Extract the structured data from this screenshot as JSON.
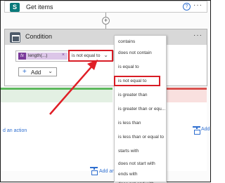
{
  "get_items": {
    "title": "Get items",
    "icon_letter": "S",
    "help": "?",
    "more": "···"
  },
  "insert": {
    "plus": "+"
  },
  "condition": {
    "title": "Condition",
    "more": "···",
    "token_label": "length(...)",
    "token_close": "×",
    "operator_value": "is not equal to",
    "operator_chevron": "⌄",
    "add_label": "Add",
    "add_plus": "+",
    "add_chevron": "⌄"
  },
  "branches": {
    "left_add_action": "d an action",
    "right_add_action": "Add",
    "bottom_add_action": "Add an a"
  },
  "dropdown": {
    "options": [
      "contains",
      "does not contain",
      "is equal to",
      "is not equal to",
      "is greater than",
      "is greater than or equ...",
      "is less than",
      "is less than or equal to",
      "starts with",
      "does not start with",
      "ends with",
      "does not end with"
    ],
    "selected_index": 3
  },
  "colors": {
    "highlight": "#d81c25",
    "accent": "#2f6fd0",
    "yes_branch": "#5db85d",
    "no_branch": "#d9534f",
    "sharepoint": "#0a7a7b",
    "token": "#dcc6e8"
  },
  "icons": [
    "sharepoint-icon",
    "help-icon",
    "more-icon",
    "condition-icon",
    "fx-icon",
    "close-icon",
    "chevron-down-icon",
    "add-action-icon"
  ]
}
